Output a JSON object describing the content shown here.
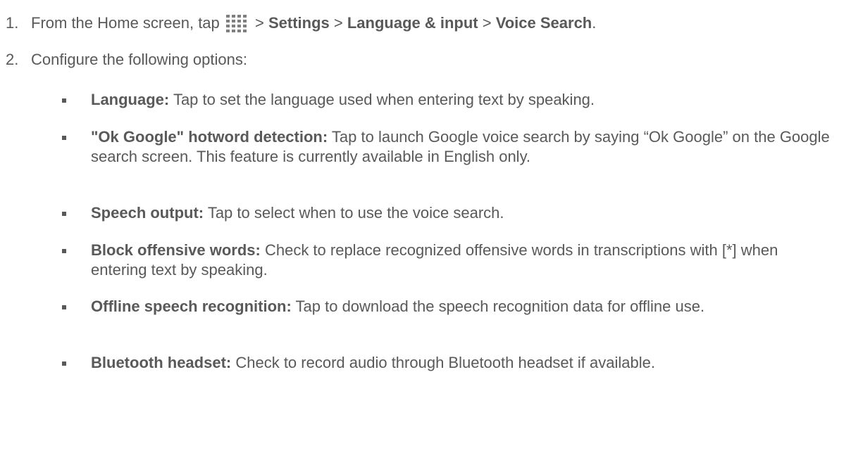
{
  "steps": [
    {
      "number": "1.",
      "lead": "From the Home screen, tap ",
      "apps_icon": "apps-grid-icon",
      "sep1": " > ",
      "path1": "Settings",
      "sep2": " > ",
      "path2": "Language & input",
      "sep3": " > ",
      "path3": "Voice Search",
      "end": "."
    },
    {
      "number": "2.",
      "text": "Configure the following options:"
    }
  ],
  "options": [
    {
      "term": "Language:",
      "desc": " Tap to set the language used when entering text by speaking."
    },
    {
      "term": "\"Ok Google\" hotword detection:",
      "desc": " Tap to launch Google voice search by saying “Ok Google” on the Google search screen. This feature is currently available in English only."
    },
    {
      "term": "Speech output:",
      "desc": " Tap to select when to use the voice search."
    },
    {
      "term": "Block offensive words:",
      "desc": " Check to replace recognized offensive words in transcriptions with [*] when entering text by speaking."
    },
    {
      "term": "Offline speech recognition:",
      "desc": " Tap to download the speech recognition data for offline use."
    },
    {
      "term": "Bluetooth headset:",
      "desc": " Check to record audio through Bluetooth headset if available."
    }
  ],
  "colors": {
    "text": "#595959",
    "icon": "#7f7f7f"
  }
}
